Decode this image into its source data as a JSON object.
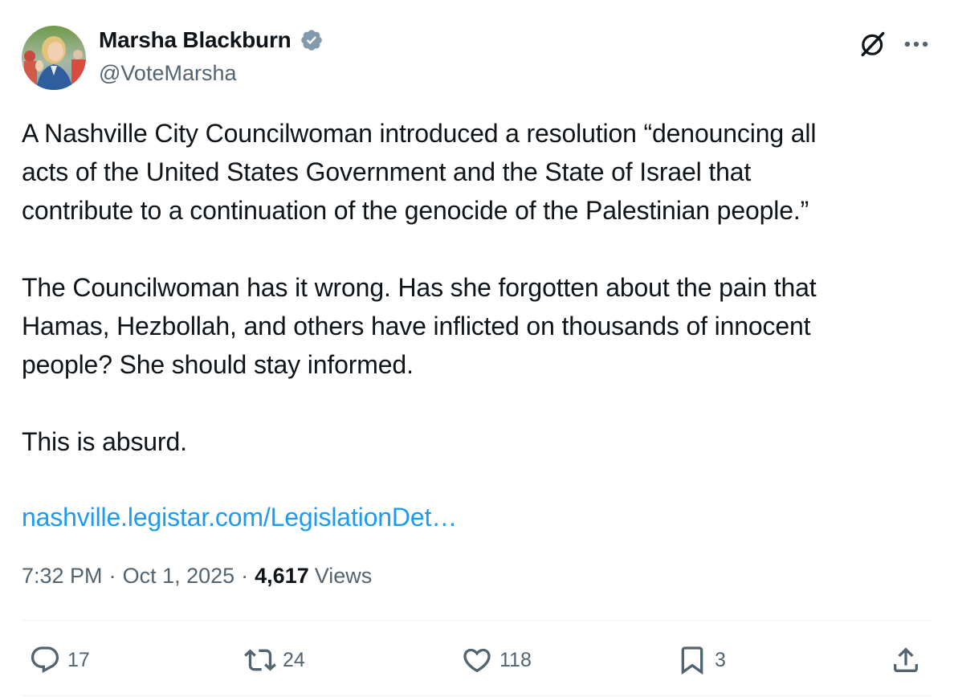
{
  "author": {
    "display_name": "Marsha Blackburn",
    "handle": "@VoteMarsha",
    "verified": true,
    "avatar_icon": "profile-photo",
    "verified_color": "#829aab"
  },
  "header_icons": {
    "grok": "grok-icon",
    "more": "more-icon"
  },
  "tweet": {
    "paragraph_1": [
      "A Nashville City Councilwoman introduced a resolution “denouncing all",
      "acts of the United States Government and the State of Israel that",
      "contribute to a continuation of the genocide of the Palestinian people.”"
    ],
    "paragraph_2": [
      "The Councilwoman has it wrong. Has she forgotten about the pain that",
      "Hamas, Hezbollah, and others have inflicted on thousands of innocent",
      "people? She should stay informed."
    ],
    "paragraph_3": "This is absurd.",
    "link_text": "nashville.legistar.com/LegislationDet…",
    "link_color": "#1d9bf0"
  },
  "meta": {
    "time": "7:32 PM",
    "separator": "·",
    "date": "Oct 1, 2025",
    "views_count": "4,617",
    "views_label": "Views"
  },
  "actions": {
    "reply": {
      "icon": "reply-icon",
      "count": "17"
    },
    "retweet": {
      "icon": "retweet-icon",
      "count": "24"
    },
    "like": {
      "icon": "heart-icon",
      "count": "118"
    },
    "bookmark": {
      "icon": "bookmark-icon",
      "count": "3"
    },
    "share": {
      "icon": "share-icon"
    }
  },
  "colors": {
    "text_primary": "#0f1419",
    "text_secondary": "#536471",
    "divider": "#eff3f4"
  }
}
